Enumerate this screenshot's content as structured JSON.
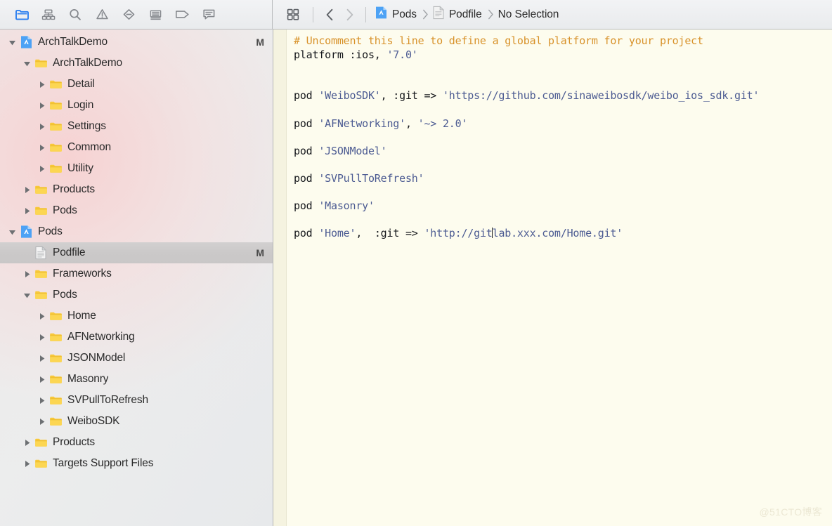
{
  "navigator_toolbar": {
    "buttons": [
      {
        "name": "project-navigator-icon",
        "label": "Project Navigator",
        "active": true
      },
      {
        "name": "symbol-navigator-icon",
        "label": "Symbol Navigator",
        "active": false
      },
      {
        "name": "search-navigator-icon",
        "label": "Find Navigator",
        "active": false
      },
      {
        "name": "issue-navigator-icon",
        "label": "Issue Navigator",
        "active": false
      },
      {
        "name": "breakpoint-navigator-icon",
        "label": "Breakpoint Navigator",
        "active": false
      },
      {
        "name": "report-navigator-icon",
        "label": "Report Navigator",
        "active": false
      },
      {
        "name": "tag-navigator-icon",
        "label": "Tag Navigator",
        "active": false
      },
      {
        "name": "comment-navigator-icon",
        "label": "Comment Navigator",
        "active": false
      }
    ]
  },
  "editor_toolbar": {
    "related_items_label": "Related Items",
    "back_label": "Go Back",
    "forward_label": "Go Forward",
    "breadcrumb": [
      {
        "label": "Pods",
        "icon": "xcode-project-icon"
      },
      {
        "label": "Podfile",
        "icon": "document-icon"
      }
    ],
    "selection_label": "No Selection",
    "separator": "›"
  },
  "navigator": {
    "tree": [
      {
        "label": "ArchTalkDemo",
        "indent": 0,
        "icon": "xcode-project-icon",
        "twisty": "open",
        "badge": "M",
        "selected": false
      },
      {
        "label": "ArchTalkDemo",
        "indent": 1,
        "icon": "folder-icon",
        "twisty": "open",
        "badge": "",
        "selected": false
      },
      {
        "label": "Detail",
        "indent": 2,
        "icon": "folder-icon",
        "twisty": "closed",
        "badge": "",
        "selected": false
      },
      {
        "label": "Login",
        "indent": 2,
        "icon": "folder-icon",
        "twisty": "closed",
        "badge": "",
        "selected": false
      },
      {
        "label": "Settings",
        "indent": 2,
        "icon": "folder-icon",
        "twisty": "closed",
        "badge": "",
        "selected": false
      },
      {
        "label": "Common",
        "indent": 2,
        "icon": "folder-icon",
        "twisty": "closed",
        "badge": "",
        "selected": false
      },
      {
        "label": "Utility",
        "indent": 2,
        "icon": "folder-icon",
        "twisty": "closed",
        "badge": "",
        "selected": false
      },
      {
        "label": "Products",
        "indent": 1,
        "icon": "folder-icon",
        "twisty": "closed",
        "badge": "",
        "selected": false
      },
      {
        "label": "Pods",
        "indent": 1,
        "icon": "folder-icon",
        "twisty": "closed",
        "badge": "",
        "selected": false
      },
      {
        "label": "Pods",
        "indent": 0,
        "icon": "xcode-project-icon",
        "twisty": "open",
        "badge": "",
        "selected": false
      },
      {
        "label": "Podfile",
        "indent": 1,
        "icon": "document-icon",
        "twisty": "none",
        "badge": "M",
        "selected": true
      },
      {
        "label": "Frameworks",
        "indent": 1,
        "icon": "folder-icon",
        "twisty": "closed",
        "badge": "",
        "selected": false
      },
      {
        "label": "Pods",
        "indent": 1,
        "icon": "folder-icon",
        "twisty": "open",
        "badge": "",
        "selected": false
      },
      {
        "label": "Home",
        "indent": 2,
        "icon": "folder-icon",
        "twisty": "closed",
        "badge": "",
        "selected": false
      },
      {
        "label": "AFNetworking",
        "indent": 2,
        "icon": "folder-icon",
        "twisty": "closed",
        "badge": "",
        "selected": false
      },
      {
        "label": "JSONModel",
        "indent": 2,
        "icon": "folder-icon",
        "twisty": "closed",
        "badge": "",
        "selected": false
      },
      {
        "label": "Masonry",
        "indent": 2,
        "icon": "folder-icon",
        "twisty": "closed",
        "badge": "",
        "selected": false
      },
      {
        "label": "SVPullToRefresh",
        "indent": 2,
        "icon": "folder-icon",
        "twisty": "closed",
        "badge": "",
        "selected": false
      },
      {
        "label": "WeiboSDK",
        "indent": 2,
        "icon": "folder-icon",
        "twisty": "closed",
        "badge": "",
        "selected": false
      },
      {
        "label": "Products",
        "indent": 1,
        "icon": "folder-icon",
        "twisty": "closed",
        "badge": "",
        "selected": false
      },
      {
        "label": "Targets Support Files",
        "indent": 1,
        "icon": "folder-icon",
        "twisty": "closed",
        "badge": "",
        "selected": false
      }
    ]
  },
  "editor": {
    "filename": "Podfile",
    "language": "ruby",
    "lines": [
      {
        "n": 1,
        "tokens": [
          {
            "t": "cmt",
            "v": "# Uncomment this line to define a global platform for your project"
          }
        ]
      },
      {
        "n": 2,
        "tokens": [
          {
            "t": "kw",
            "v": "platform :ios, "
          },
          {
            "t": "str",
            "v": "'7.0'"
          }
        ]
      },
      {
        "n": 3,
        "tokens": []
      },
      {
        "n": 4,
        "tokens": []
      },
      {
        "n": 5,
        "tokens": [
          {
            "t": "kw",
            "v": "pod "
          },
          {
            "t": "str",
            "v": "'WeiboSDK'"
          },
          {
            "t": "kw",
            "v": ", :git => "
          },
          {
            "t": "str",
            "v": "'https://github.com/sinaweibosdk/weibo_ios_sdk.git'"
          }
        ]
      },
      {
        "n": 6,
        "tokens": []
      },
      {
        "n": 7,
        "tokens": [
          {
            "t": "kw",
            "v": "pod "
          },
          {
            "t": "str",
            "v": "'AFNetworking'"
          },
          {
            "t": "kw",
            "v": ", "
          },
          {
            "t": "str",
            "v": "'~> 2.0'"
          }
        ]
      },
      {
        "n": 8,
        "tokens": []
      },
      {
        "n": 9,
        "tokens": [
          {
            "t": "kw",
            "v": "pod "
          },
          {
            "t": "str",
            "v": "'JSONModel'"
          }
        ]
      },
      {
        "n": 10,
        "tokens": []
      },
      {
        "n": 11,
        "tokens": [
          {
            "t": "kw",
            "v": "pod "
          },
          {
            "t": "str",
            "v": "'SVPullToRefresh'"
          }
        ]
      },
      {
        "n": 12,
        "tokens": []
      },
      {
        "n": 13,
        "tokens": [
          {
            "t": "kw",
            "v": "pod "
          },
          {
            "t": "str",
            "v": "'Masonry'"
          }
        ]
      },
      {
        "n": 14,
        "tokens": []
      },
      {
        "n": 15,
        "tokens": [
          {
            "t": "kw",
            "v": "pod "
          },
          {
            "t": "str",
            "v": "'Home'"
          },
          {
            "t": "kw",
            "v": ",  :git => "
          },
          {
            "t": "str",
            "v": "'http://git"
          },
          {
            "t": "caret",
            "v": ""
          },
          {
            "t": "str",
            "v": "lab.xxx.com/Home.git'"
          }
        ]
      }
    ]
  },
  "watermark": {
    "text": "@51CTO博客"
  }
}
